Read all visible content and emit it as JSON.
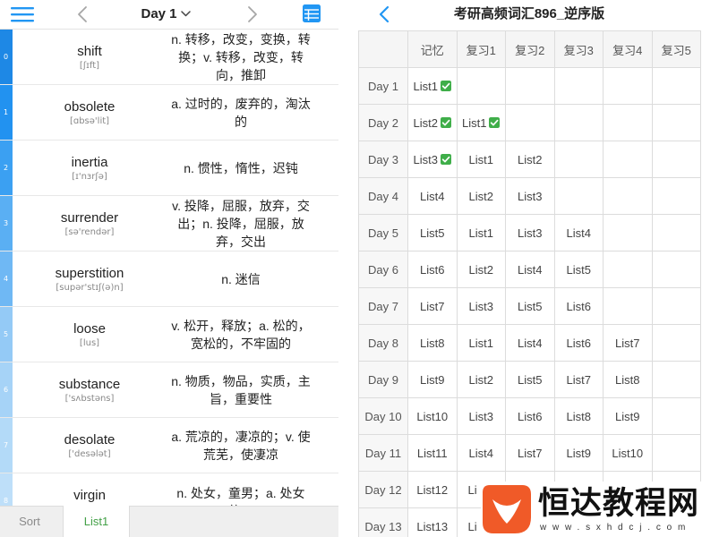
{
  "left_app": {
    "header": {
      "title": "Day 1",
      "menu_icon": "hamburger-menu-icon",
      "prev_icon": "chevron-left-icon",
      "next_icon": "chevron-right-icon",
      "dropdown_icon": "chevron-down-icon",
      "list_icon": "table-list-icon"
    },
    "accent_color": "#2196f3",
    "stripe_colors": [
      "#1e88e5",
      "#2292f0",
      "#3ba0f2",
      "#5aaff3",
      "#6fb8f4",
      "#94caf6",
      "#a6d3f7",
      "#b3daf8",
      "#bedff9"
    ],
    "words": [
      {
        "index": "0",
        "word": "shift",
        "phonetic": "[ʃɪft]",
        "meaning": "n. 转移，改变，变换，转换；v. 转移，改变，转向，推卸"
      },
      {
        "index": "1",
        "word": "obsolete",
        "phonetic": "[ɑbsə'lit]",
        "meaning": "a. 过时的，废弃的，淘汰的"
      },
      {
        "index": "2",
        "word": "inertia",
        "phonetic": "[ɪ'nɜrʃə]",
        "meaning": "n. 惯性，惰性，迟钝"
      },
      {
        "index": "3",
        "word": "surrender",
        "phonetic": "[sə'rendər]",
        "meaning": "v. 投降，屈服，放弃，交出；n. 投降，屈服，放弃，交出"
      },
      {
        "index": "4",
        "word": "superstition",
        "phonetic": "[supər'stɪʃ(ə)n]",
        "meaning": "n. 迷信"
      },
      {
        "index": "5",
        "word": "loose",
        "phonetic": "[lus]",
        "meaning": "v. 松开，释放；a. 松的，宽松的，不牢固的"
      },
      {
        "index": "6",
        "word": "substance",
        "phonetic": "['sʌbstəns]",
        "meaning": "n. 物质，物品，实质，主旨，重要性"
      },
      {
        "index": "7",
        "word": "desolate",
        "phonetic": "['desələt]",
        "meaning": "a. 荒凉的，凄凉的；v. 使荒芜，使凄凉"
      },
      {
        "index": "8",
        "word": "virgin",
        "meaning": "n. 处女，童男；a. 处女的，"
      }
    ],
    "bottom_tabs": [
      {
        "label": "Sort",
        "selected": false
      },
      {
        "label": "List1",
        "selected": true
      }
    ],
    "selected_tab_color": "#43a047"
  },
  "right_app": {
    "title": "考研高频词汇896_逆序版",
    "back_icon": "chevron-left-icon",
    "accent_color": "#2196f3",
    "check_color": "#3fae49",
    "columns": [
      "记忆",
      "复习1",
      "复习2",
      "复习3",
      "复习4",
      "复习5"
    ],
    "rows": [
      {
        "day": "Day 1",
        "cells": [
          {
            "text": "List1",
            "done": true
          },
          {
            "text": ""
          },
          {
            "text": ""
          },
          {
            "text": ""
          },
          {
            "text": ""
          },
          {
            "text": ""
          }
        ]
      },
      {
        "day": "Day 2",
        "cells": [
          {
            "text": "List2",
            "done": true
          },
          {
            "text": "List1",
            "done": true
          },
          {
            "text": ""
          },
          {
            "text": ""
          },
          {
            "text": ""
          },
          {
            "text": ""
          }
        ]
      },
      {
        "day": "Day 3",
        "cells": [
          {
            "text": "List3",
            "done": true
          },
          {
            "text": "List1"
          },
          {
            "text": "List2"
          },
          {
            "text": ""
          },
          {
            "text": ""
          },
          {
            "text": ""
          }
        ]
      },
      {
        "day": "Day 4",
        "cells": [
          {
            "text": "List4"
          },
          {
            "text": "List2"
          },
          {
            "text": "List3"
          },
          {
            "text": ""
          },
          {
            "text": ""
          },
          {
            "text": ""
          }
        ]
      },
      {
        "day": "Day 5",
        "cells": [
          {
            "text": "List5"
          },
          {
            "text": "List1"
          },
          {
            "text": "List3"
          },
          {
            "text": "List4"
          },
          {
            "text": ""
          },
          {
            "text": ""
          }
        ]
      },
      {
        "day": "Day 6",
        "cells": [
          {
            "text": "List6"
          },
          {
            "text": "List2"
          },
          {
            "text": "List4"
          },
          {
            "text": "List5"
          },
          {
            "text": ""
          },
          {
            "text": ""
          }
        ]
      },
      {
        "day": "Day 7",
        "cells": [
          {
            "text": "List7"
          },
          {
            "text": "List3"
          },
          {
            "text": "List5"
          },
          {
            "text": "List6"
          },
          {
            "text": ""
          },
          {
            "text": ""
          }
        ]
      },
      {
        "day": "Day 8",
        "cells": [
          {
            "text": "List8"
          },
          {
            "text": "List1"
          },
          {
            "text": "List4"
          },
          {
            "text": "List6"
          },
          {
            "text": "List7"
          },
          {
            "text": ""
          }
        ]
      },
      {
        "day": "Day 9",
        "cells": [
          {
            "text": "List9"
          },
          {
            "text": "List2"
          },
          {
            "text": "List5"
          },
          {
            "text": "List7"
          },
          {
            "text": "List8"
          },
          {
            "text": ""
          }
        ]
      },
      {
        "day": "Day 10",
        "cells": [
          {
            "text": "List10"
          },
          {
            "text": "List3"
          },
          {
            "text": "List6"
          },
          {
            "text": "List8"
          },
          {
            "text": "List9"
          },
          {
            "text": ""
          }
        ]
      },
      {
        "day": "Day 11",
        "cells": [
          {
            "text": "List11"
          },
          {
            "text": "List4"
          },
          {
            "text": "List7"
          },
          {
            "text": "List9"
          },
          {
            "text": "List10"
          },
          {
            "text": ""
          }
        ]
      },
      {
        "day": "Day 12",
        "cells": [
          {
            "text": "List12"
          },
          {
            "text": "Li"
          },
          {
            "text": ""
          },
          {
            "text": ""
          },
          {
            "text": ""
          },
          {
            "text": ""
          }
        ]
      },
      {
        "day": "Day 13",
        "cells": [
          {
            "text": "List13"
          },
          {
            "text": "Li"
          },
          {
            "text": ""
          },
          {
            "text": ""
          },
          {
            "text": ""
          },
          {
            "text": ""
          }
        ]
      }
    ]
  },
  "watermark": {
    "logo_icon": "watermark-logo-icon",
    "logo_color": "#f05a28",
    "name": "恒达教程网",
    "url": "www.sxhdcj.com"
  }
}
